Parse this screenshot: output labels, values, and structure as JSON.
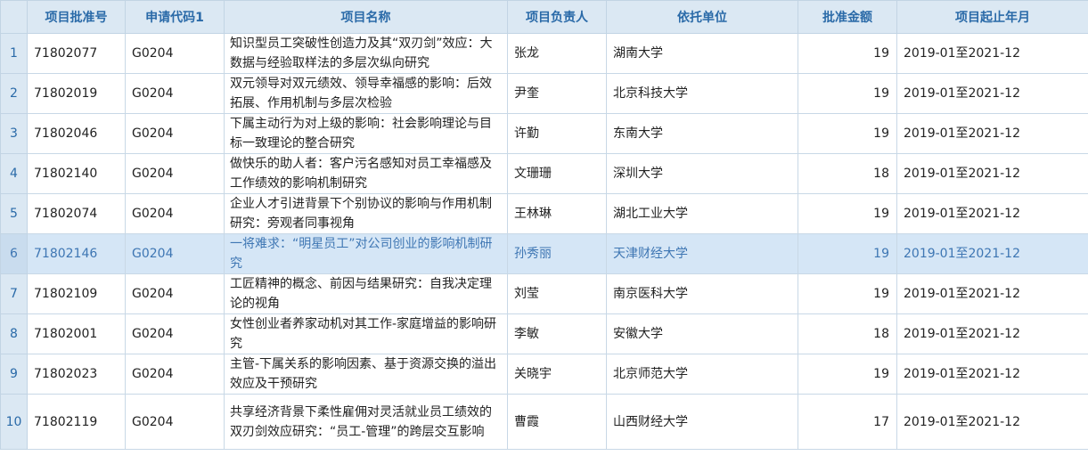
{
  "table": {
    "headers": [
      "",
      "项目批准号",
      "申请代码1",
      "项目名称",
      "项目负责人",
      "依托单位",
      "批准金额",
      "项目起止年月"
    ],
    "highlighted_row": 6,
    "rows": [
      {
        "idx": "1",
        "no": "71802077",
        "code": "G0204",
        "name": "知识型员工突破性创造力及其“双刃剑”效应：大数据与经验取样法的多层次纵向研究",
        "lead": "张龙",
        "unit": "湖南大学",
        "amount": "19",
        "period": "2019-01至2021-12"
      },
      {
        "idx": "2",
        "no": "71802019",
        "code": "G0204",
        "name": "双元领导对双元绩效、领导幸福感的影响：后效拓展、作用机制与多层次检验",
        "lead": "尹奎",
        "unit": "北京科技大学",
        "amount": "19",
        "period": "2019-01至2021-12"
      },
      {
        "idx": "3",
        "no": "71802046",
        "code": "G0204",
        "name": "下属主动行为对上级的影响：社会影响理论与目标一致理论的整合研究",
        "lead": "许勤",
        "unit": "东南大学",
        "amount": "19",
        "period": "2019-01至2021-12"
      },
      {
        "idx": "4",
        "no": "71802140",
        "code": "G0204",
        "name": "做快乐的助人者：客户污名感知对员工幸福感及工作绩效的影响机制研究",
        "lead": "文珊珊",
        "unit": "深圳大学",
        "amount": "18",
        "period": "2019-01至2021-12"
      },
      {
        "idx": "5",
        "no": "71802074",
        "code": "G0204",
        "name": "企业人才引进背景下个别协议的影响与作用机制研究：旁观者同事视角",
        "lead": "王林琳",
        "unit": "湖北工业大学",
        "amount": "19",
        "period": "2019-01至2021-12"
      },
      {
        "idx": "6",
        "no": "71802146",
        "code": "G0204",
        "name": "一将难求：“明星员工”对公司创业的影响机制研究",
        "lead": "孙秀丽",
        "unit": "天津财经大学",
        "amount": "19",
        "period": "2019-01至2021-12"
      },
      {
        "idx": "7",
        "no": "71802109",
        "code": "G0204",
        "name": "工匠精神的概念、前因与结果研究：自我决定理论的视角",
        "lead": "刘莹",
        "unit": "南京医科大学",
        "amount": "19",
        "period": "2019-01至2021-12"
      },
      {
        "idx": "8",
        "no": "71802001",
        "code": "G0204",
        "name": "女性创业者养家动机对其工作-家庭增益的影响研究",
        "lead": "李敏",
        "unit": "安徽大学",
        "amount": "18",
        "period": "2019-01至2021-12"
      },
      {
        "idx": "9",
        "no": "71802023",
        "code": "G0204",
        "name": "主管-下属关系的影响因素、基于资源交换的溢出效应及干预研究",
        "lead": "关晓宇",
        "unit": "北京师范大学",
        "amount": "19",
        "period": "2019-01至2021-12"
      },
      {
        "idx": "10",
        "no": "71802119",
        "code": "G0204",
        "name": "共享经济背景下柔性雇佣对灵活就业员工绩效的双刃剑效应研究：“员工-管理”的跨层交互影响",
        "lead": "曹霞",
        "unit": "山西财经大学",
        "amount": "17",
        "period": "2019-01至2021-12"
      }
    ]
  },
  "colors": {
    "header_bg": "#dbe8f3",
    "header_text": "#2a6aa8",
    "highlight_bg": "#d5e6f6",
    "grid": "#c8d8e6"
  }
}
